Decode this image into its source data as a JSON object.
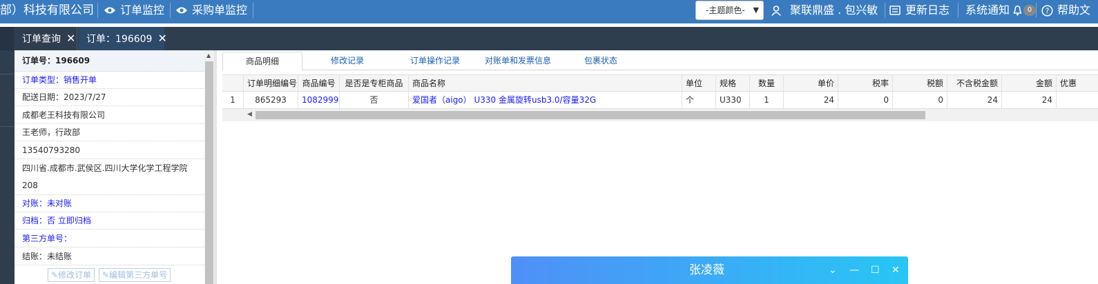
{
  "header": {
    "company": "部）科技有限公司",
    "nav": [
      {
        "label": "订单监控",
        "icon": "eye-icon"
      },
      {
        "label": "采购单监控",
        "icon": "eye-icon"
      }
    ],
    "theme_select": "-主题颜色-",
    "user": "聚联鼎盛 . 包兴敏",
    "update_log": "更新日志",
    "notifications": "系统通知",
    "notification_count": "0",
    "help": "帮助文"
  },
  "tabs": [
    {
      "label": "订单查询"
    },
    {
      "label": "订单：196609"
    }
  ],
  "order_info": {
    "order_no": "订单号：196609",
    "order_type": "订单类型：销售开单",
    "delivery_date": "配送日期：2023/7/27",
    "customer": "成都老王科技有限公司",
    "contact": "王老师，行政部",
    "phone": "13540793280",
    "address": "四川省.成都市.武侯区.四川大学化学工程学院208",
    "reconcile": "对账：未对账",
    "archive": "归档：否 立即归档",
    "third_party_no": "第三方单号：",
    "settlement": "结账：未结账",
    "btn_edit_order": "修改订单",
    "btn_edit_third": "编辑第三方单号"
  },
  "subtabs": [
    {
      "label": "商品明细",
      "active": true
    },
    {
      "label": "修改记录"
    },
    {
      "label": "订单操作记录"
    },
    {
      "label": "对账单和发票信息"
    },
    {
      "label": "包裹状态"
    }
  ],
  "table": {
    "columns": [
      "",
      "订单明细编号",
      "商品编号",
      "是否是专柜商品",
      "商品名称",
      "单位",
      "规格",
      "数量",
      "单价",
      "税率",
      "税额",
      "不含税金额",
      "金额",
      "优惠"
    ],
    "rows": [
      [
        "1",
        "865293",
        "1082999",
        "否",
        "爱国者（aigo） U330 金属旋转usb3.0/容量32G",
        "个",
        "U330",
        "1",
        "24",
        "0",
        "0",
        "24",
        "24",
        ""
      ]
    ]
  },
  "chat": {
    "name": "张凌薇"
  },
  "colors": {
    "header_bg": "#3a7bbf",
    "tabbar_bg": "#2f3e4f",
    "link": "#1a1aff",
    "chat_gradient_start": "#4f8ff7",
    "chat_gradient_end": "#28c6f5"
  }
}
